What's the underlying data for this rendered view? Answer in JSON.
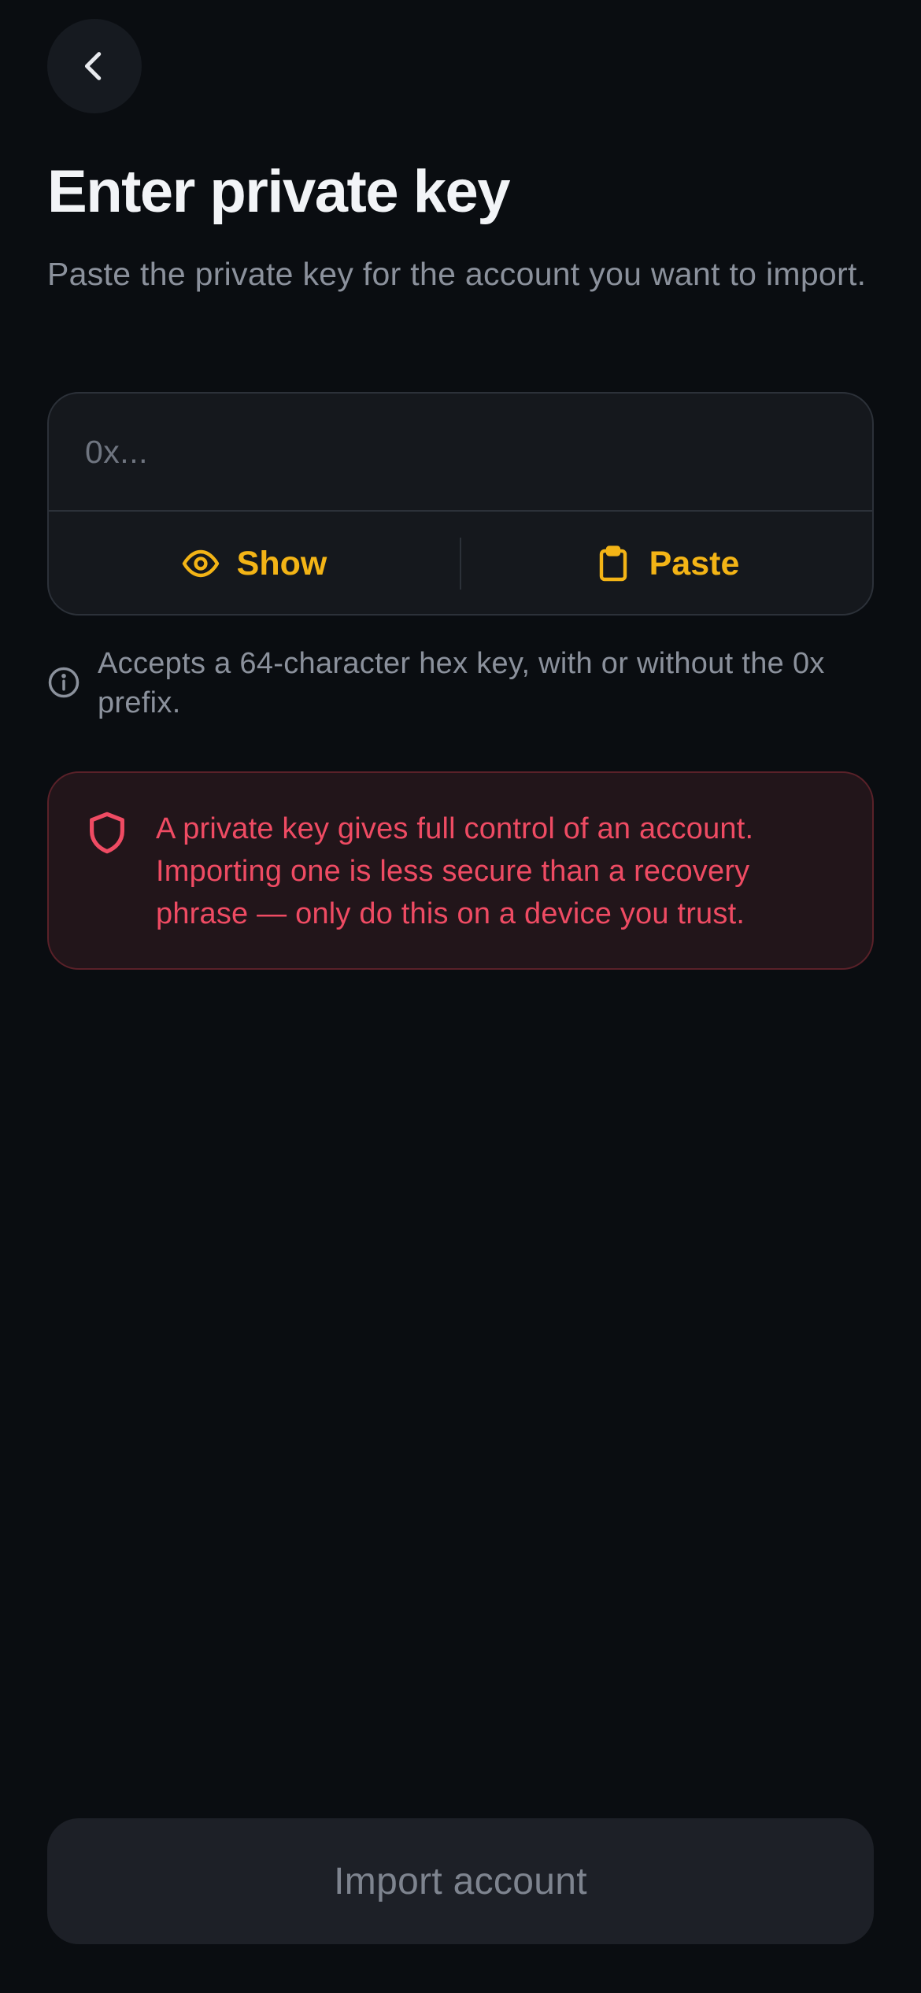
{
  "header": {
    "back_icon": "chevron-left-icon",
    "title": "Enter private key",
    "subtitle": "Paste the private key for the account you want to import."
  },
  "key_field": {
    "value": "",
    "placeholder": "0x...",
    "show_label": "Show",
    "show_icon": "eye-icon",
    "paste_label": "Paste",
    "paste_icon": "clipboard-icon"
  },
  "hint": {
    "icon": "info-icon",
    "text": "Accepts a 64-character hex key, with or without the 0x prefix."
  },
  "warning": {
    "icon": "shield-icon",
    "text": "A private key gives full control of an account. Importing one is less secure than a recovery phrase — only do this on a device you trust."
  },
  "footer": {
    "import_label": "Import account",
    "import_enabled": false
  },
  "colors": {
    "background": "#0a0d11",
    "accent": "#f3b416",
    "danger": "#ef4b63",
    "muted_text": "#8b919c"
  }
}
